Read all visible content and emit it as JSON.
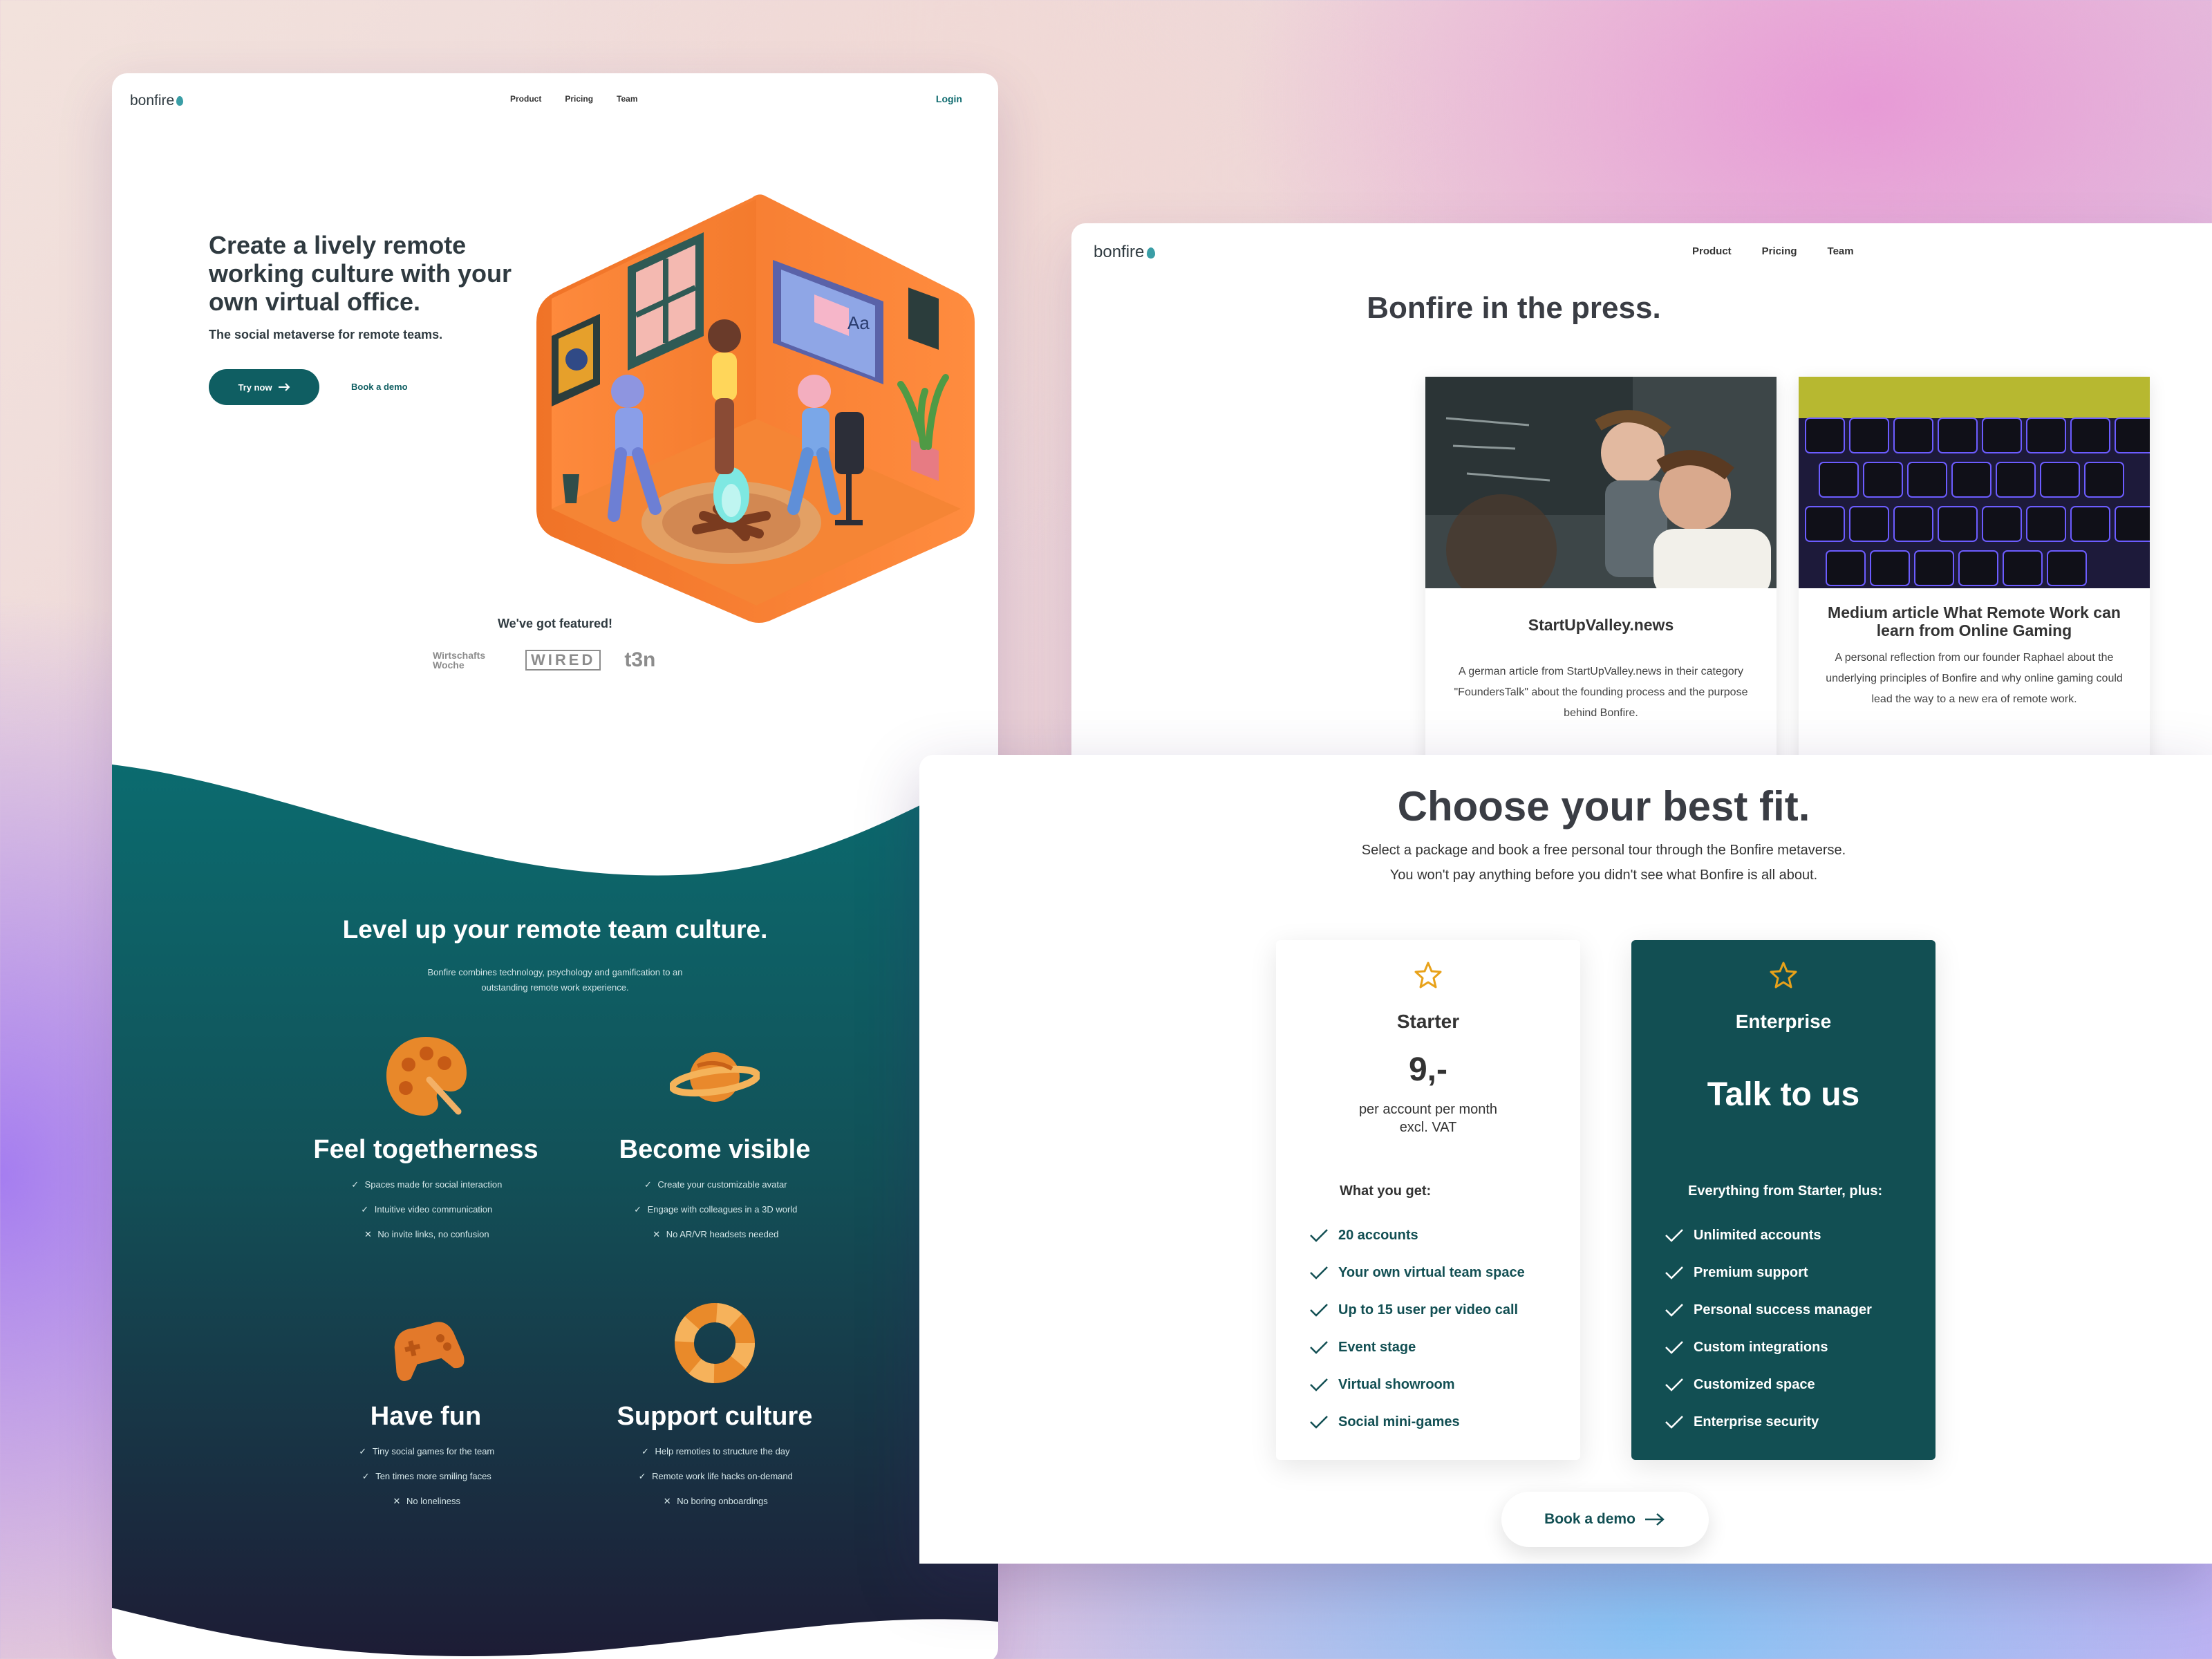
{
  "landing": {
    "logo": "bonfire",
    "nav": [
      "Product",
      "Pricing",
      "Team"
    ],
    "login": "Login",
    "hero_title": "Create a lively remote working culture with your own virtual office.",
    "hero_subtitle": "The social metaverse for remote teams.",
    "try_now": "Try now",
    "book_demo": "Book a demo",
    "featured_title": "We've got featured!",
    "press_logos": [
      "Wirtschafts Woche",
      "WIRED",
      "t3n"
    ],
    "culture_title": "Level up your remote team culture.",
    "culture_subtitle": "Bonfire combines technology, psychology and gamification to an outstanding remote work experience.",
    "features": [
      {
        "icon": "palette-icon",
        "title": "Feel togetherness",
        "items": [
          {
            "mark": "check",
            "text": "Spaces made for social interaction"
          },
          {
            "mark": "check",
            "text": "Intuitive video communication"
          },
          {
            "mark": "cross",
            "text": "No invite links, no confusion"
          }
        ]
      },
      {
        "icon": "planet-icon",
        "title": "Become visible",
        "items": [
          {
            "mark": "check",
            "text": "Create your customizable avatar"
          },
          {
            "mark": "check",
            "text": "Engage with colleagues in a 3D world"
          },
          {
            "mark": "cross",
            "text": "No AR/VR headsets needed"
          }
        ]
      },
      {
        "icon": "gamepad-icon",
        "title": "Have fun",
        "items": [
          {
            "mark": "check",
            "text": "Tiny social games for the team"
          },
          {
            "mark": "check",
            "text": "Ten times more smiling faces"
          },
          {
            "mark": "cross",
            "text": "No loneliness"
          }
        ]
      },
      {
        "icon": "lifebuoy-icon",
        "title": "Support culture",
        "items": [
          {
            "mark": "check",
            "text": "Help remoties to structure the day"
          },
          {
            "mark": "check",
            "text": "Remote work life hacks on-demand"
          },
          {
            "mark": "cross",
            "text": "No boring onboardings"
          }
        ]
      }
    ]
  },
  "press": {
    "logo": "bonfire",
    "nav": [
      "Product",
      "Pricing",
      "Team"
    ],
    "title": "Bonfire in the press.",
    "cards": [
      {
        "title": "StartUpValley.news",
        "text": "A german article from StartUpValley.news in their category \"FoundersTalk\" about the founding process and the purpose behind Bonfire."
      },
      {
        "title": "Medium article What Remote Work can learn from Online Gaming",
        "text": "A personal reflection from our founder Raphael about the underlying principles of Bonfire and why online gaming could lead the way to a new era of remote work."
      }
    ]
  },
  "pricing": {
    "title": "Choose your best fit.",
    "subtitle_1": "Select a package and book a free personal tour through the Bonfire metaverse.",
    "subtitle_2": "You won't pay anything before you didn't see what Bonfire is all about.",
    "starter": {
      "name": "Starter",
      "price": "9,-",
      "period_1": "per account per month",
      "period_2": "excl. VAT",
      "features_title": "What you get:",
      "features": [
        "20 accounts",
        "Your own virtual team space",
        "Up to 15 user per video call",
        "Event stage",
        "Virtual showroom",
        "Social mini-games"
      ]
    },
    "enterprise": {
      "name": "Enterprise",
      "price": "Talk to us",
      "features_title": "Everything from Starter, plus:",
      "features": [
        "Unlimited accounts",
        "Premium support",
        "Personal success manager",
        "Custom integrations",
        "Customized space",
        "Enterprise security"
      ]
    },
    "book_demo": "Book a demo"
  },
  "colors": {
    "teal": "#124f53",
    "accent_orange": "#ff8a3d",
    "star_gold": "#e8a21a"
  }
}
